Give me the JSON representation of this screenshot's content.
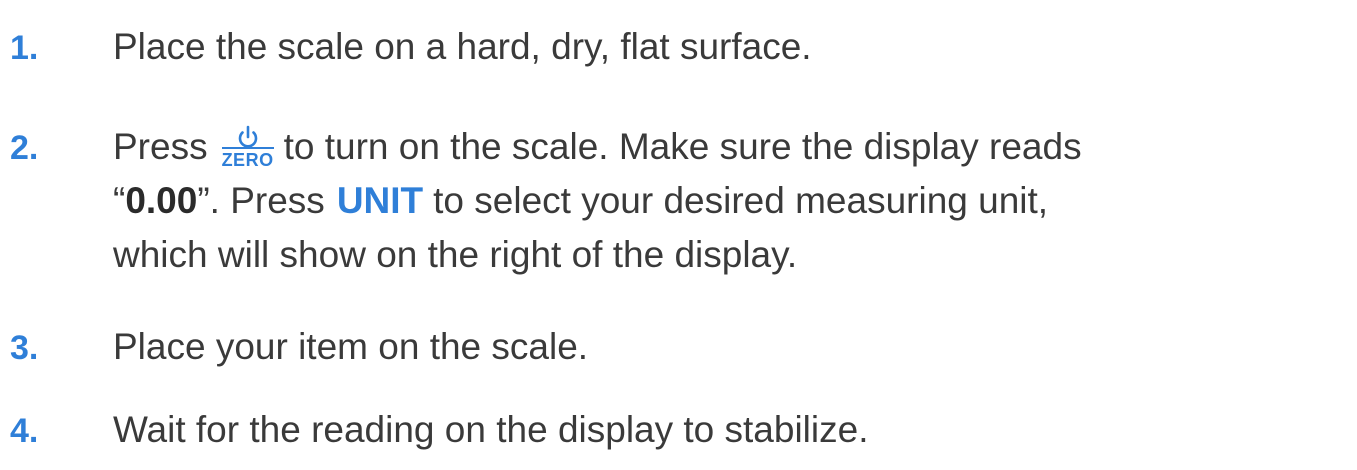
{
  "steps": [
    {
      "number": "1.",
      "text": "Place the scale on a hard, dry, flat surface."
    },
    {
      "number": "2.",
      "press_word": "Press",
      "power_key_label": "ZERO",
      "after_power": "to turn on the scale. Make sure the display reads",
      "quote_open": "“",
      "reading": "0.00",
      "after_reading": "”. Press",
      "unit_key_label": "UNIT",
      "after_unit": "to select your desired measuring unit,",
      "line3": "which will show on the right of the display."
    },
    {
      "number": "3.",
      "text": "Place your item on the scale."
    },
    {
      "number": "4.",
      "text": "Wait for the reading on the display to stabilize."
    }
  ],
  "colors": {
    "accent": "#2f7fd8",
    "text": "#3a3a3a"
  },
  "icons": {
    "power": "power-icon"
  }
}
